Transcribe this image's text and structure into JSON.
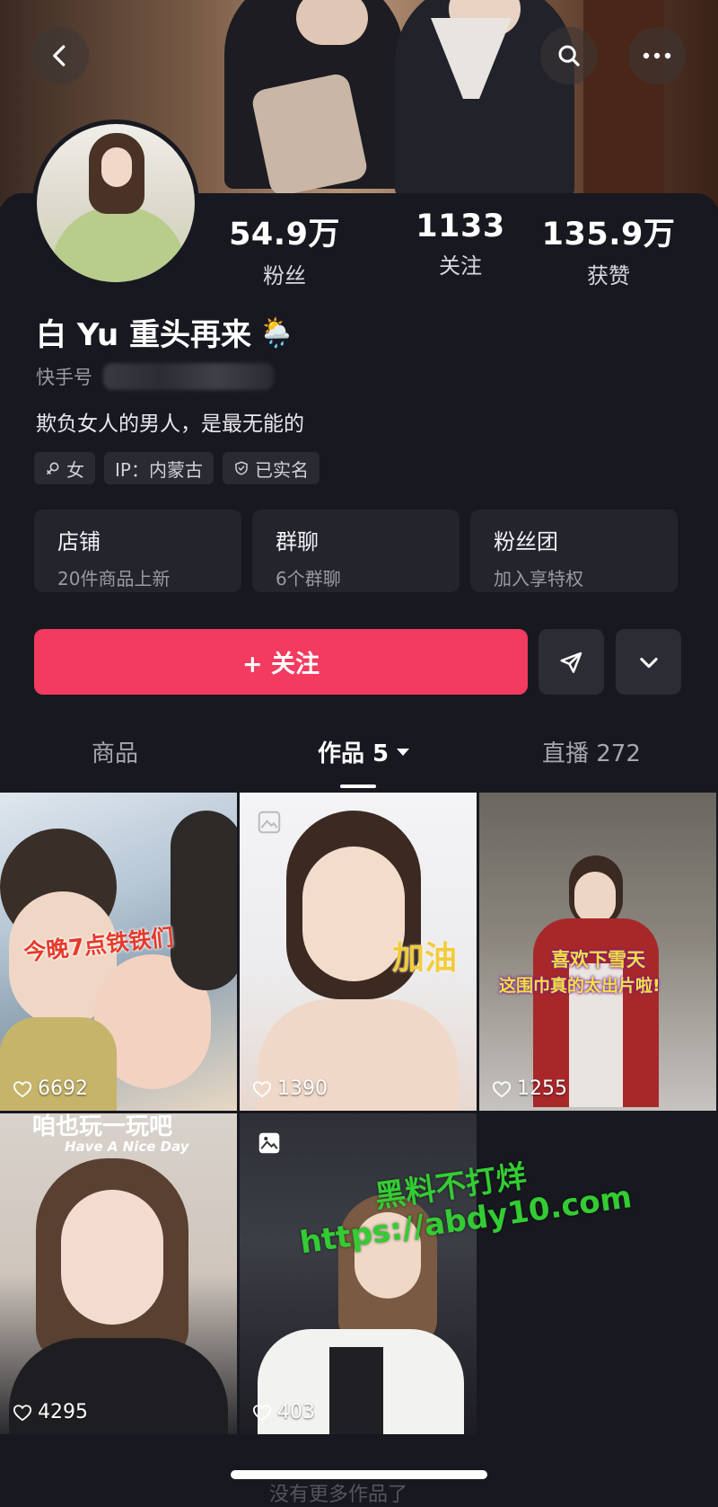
{
  "header": {
    "back_icon": "chevron-left-icon",
    "search_icon": "search-icon",
    "more_icon": "more-horizontal-icon"
  },
  "profile": {
    "nickname": "白 Yu 重头再来",
    "nickname_emoji": "🌦️",
    "id_label": "快手号",
    "bio": "欺负女人的男人，是最无能的",
    "tags": [
      {
        "icon": "female-icon",
        "label": "女"
      },
      {
        "icon": "",
        "label": "IP：内蒙古"
      },
      {
        "icon": "shield-check-icon",
        "label": "已实名"
      }
    ]
  },
  "stats": {
    "fans": {
      "value": "54.9万",
      "label": "粉丝"
    },
    "following": {
      "value": "1133",
      "label": "关注"
    },
    "likes": {
      "value": "135.9万",
      "label": "获赞"
    }
  },
  "cards": [
    {
      "title": "店铺",
      "subtitle": "20件商品上新"
    },
    {
      "title": "群聊",
      "subtitle": "6个群聊"
    },
    {
      "title": "粉丝团",
      "subtitle": "加入享特权"
    }
  ],
  "actions": {
    "follow_label": "+ 关注",
    "follow_color": "#f33a5f",
    "share_icon": "send-icon",
    "expand_icon": "chevron-down-icon"
  },
  "tabs": {
    "goods": "商品",
    "works": "作品 5",
    "live": "直播 272"
  },
  "videos": [
    {
      "likes": "6692",
      "cover_text": "今晚7点铁铁们"
    },
    {
      "likes": "1390",
      "cover_text": "加油"
    },
    {
      "likes": "1255",
      "cover_text": "喜欢下雪天",
      "cover_text_2": "这围巾真的太出片啦!"
    },
    {
      "likes": "4295",
      "cover_text": "咱也玩一玩吧",
      "cover_text_2": "Have A Nice Day"
    },
    {
      "likes": "403"
    }
  ],
  "watermark": {
    "line1": "黑料不打烊",
    "line2": "https://abdy10.com"
  },
  "footer_hint": "没有更多作品了"
}
